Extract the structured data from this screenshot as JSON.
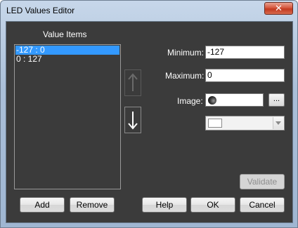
{
  "window": {
    "title": "LED Values Editor",
    "close_glyph": "✕"
  },
  "values": {
    "heading": "Value Items",
    "items": [
      {
        "label": "-127 : 0",
        "selected": true
      },
      {
        "label": "0 : 127",
        "selected": false
      }
    ]
  },
  "properties": {
    "minimum_label": "Minimum:",
    "minimum_value": "-127",
    "maximum_label": "Maximum:",
    "maximum_value": "0",
    "image_label": "Image:",
    "browse_label": "...",
    "image_icon": "dark-led-icon",
    "color_swatch": "#ffffff"
  },
  "buttons": {
    "move_up_icon": "arrow-up-icon",
    "move_down_icon": "arrow-down-icon",
    "validate": "Validate",
    "add": "Add",
    "remove": "Remove",
    "help": "Help",
    "ok": "OK",
    "cancel": "Cancel"
  },
  "colors": {
    "panel": "#3b3b3b",
    "selection": "#3399ff",
    "close_button": "#c8402a"
  }
}
